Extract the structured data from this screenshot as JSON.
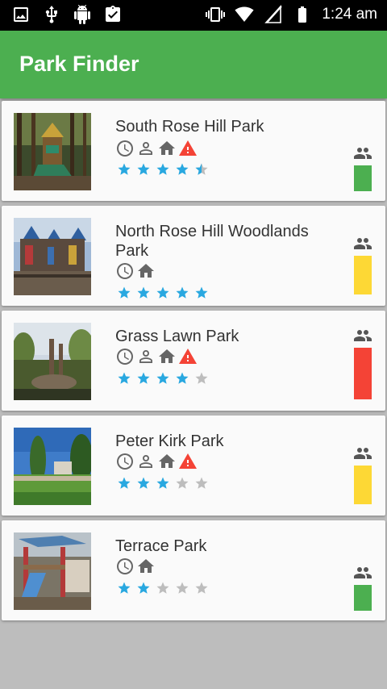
{
  "status_bar": {
    "time": "1:24 am",
    "left_icons": [
      "image-icon",
      "usb-icon",
      "android-icon",
      "clipboard-check-icon"
    ],
    "right_icons": [
      "vibrate-icon",
      "wifi-icon",
      "no-signal-icon",
      "battery-icon"
    ]
  },
  "app": {
    "title": "Park Finder",
    "accent_color": "#4caf50"
  },
  "parks": [
    {
      "name": "South Rose Hill Park",
      "amenities": [
        "clock-icon",
        "person-icon",
        "home-icon",
        "warning-icon"
      ],
      "rating": 4.5,
      "crowd_level_color": "#4caf50",
      "crowd_level": "low"
    },
    {
      "name": "North Rose Hill Woodlands Park",
      "amenities": [
        "clock-icon",
        "home-icon"
      ],
      "rating": 5,
      "crowd_level_color": "#fdd835",
      "crowd_level": "medium"
    },
    {
      "name": "Grass Lawn Park",
      "amenities": [
        "clock-icon",
        "person-icon",
        "home-icon",
        "warning-icon"
      ],
      "rating": 4,
      "crowd_level_color": "#f44336",
      "crowd_level": "high"
    },
    {
      "name": "Peter Kirk Park",
      "amenities": [
        "clock-icon",
        "person-icon",
        "home-icon",
        "warning-icon"
      ],
      "rating": 3,
      "crowd_level_color": "#fdd835",
      "crowd_level": "medium"
    },
    {
      "name": "Terrace Park",
      "amenities": [
        "clock-icon",
        "home-icon"
      ],
      "rating": 2,
      "crowd_level_color": "#4caf50",
      "crowd_level": "low"
    }
  ]
}
